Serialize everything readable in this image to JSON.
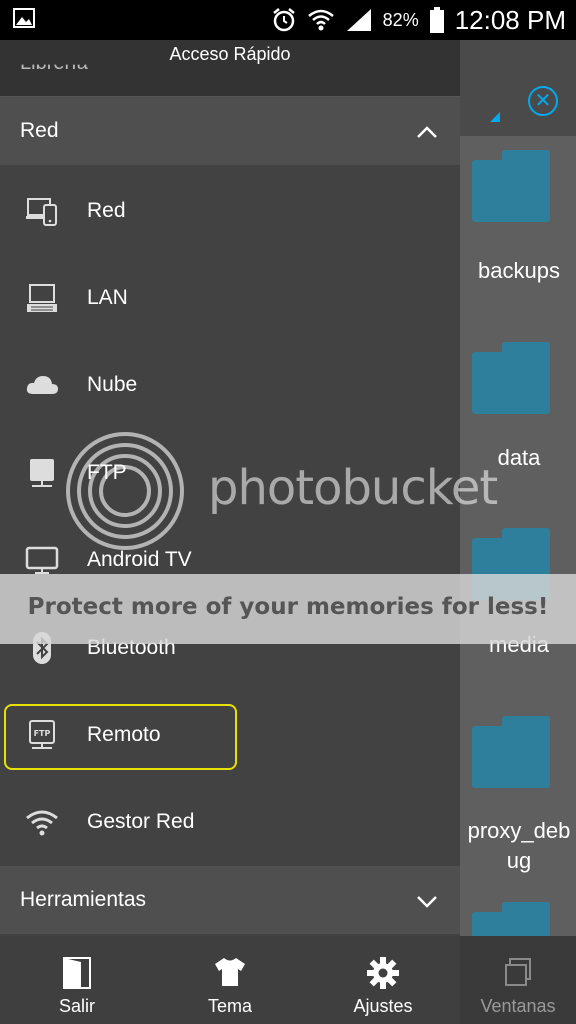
{
  "status_bar": {
    "battery_pct": "82%",
    "time": "12:08 PM"
  },
  "background_app": {
    "folders": [
      "backups",
      "data",
      "media",
      "proxy_deb",
      "ug"
    ]
  },
  "drawer": {
    "title": "Acceso Rápido",
    "peek_item": "Librería",
    "section_red": {
      "label": "Red",
      "expanded": true
    },
    "items": [
      {
        "label": "Red",
        "icon": "network-devices-icon"
      },
      {
        "label": "LAN",
        "icon": "lan-computer-icon"
      },
      {
        "label": "Nube",
        "icon": "cloud-icon"
      },
      {
        "label": "FTP",
        "icon": "ftp-server-icon"
      },
      {
        "label": "Android TV",
        "icon": "tv-icon"
      },
      {
        "label": "Bluetooth",
        "icon": "bluetooth-icon"
      },
      {
        "label": "Remoto",
        "icon": "remote-ftp-icon",
        "highlighted": true
      },
      {
        "label": "Gestor Red",
        "icon": "wifi-manager-icon"
      }
    ],
    "section_tools": {
      "label": "Herramientas",
      "expanded": false
    }
  },
  "bottom_nav": {
    "salir": "Salir",
    "tema": "Tema",
    "ajustes": "Ajustes",
    "ventanas": "Ventanas"
  },
  "watermark": {
    "brand": "photobucket",
    "banner": "Protect more of your memories for less!"
  },
  "colors": {
    "accent_blue": "#00aaee",
    "highlight_yellow": "#e8e000",
    "folder_teal": "#2e7f9b"
  }
}
